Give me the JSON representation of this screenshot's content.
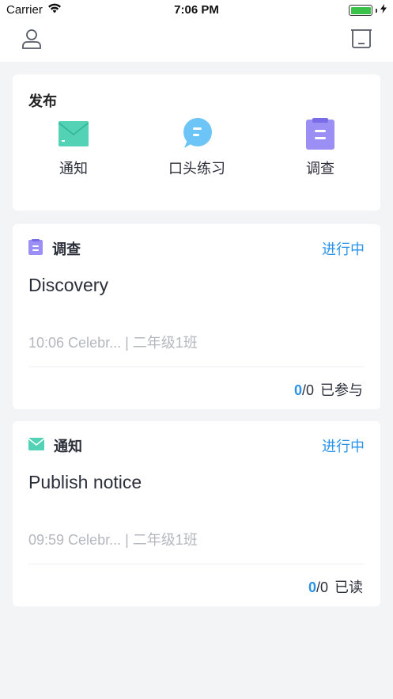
{
  "status_bar": {
    "carrier": "Carrier",
    "time": "7:06 PM",
    "battery_level": 1.0
  },
  "nav": {
    "left_icon": "user-icon",
    "right_icon": "inbox-icon"
  },
  "publish": {
    "title": "发布",
    "items": [
      {
        "label": "通知",
        "icon": "mail-icon",
        "color": "#53d2b5"
      },
      {
        "label": "口头练习",
        "icon": "chat-bubble-icon",
        "color": "#6cc4f7"
      },
      {
        "label": "调查",
        "icon": "clipboard-icon",
        "color": "#9b8ef5"
      }
    ]
  },
  "cards": [
    {
      "type": "调查",
      "icon": "clipboard-icon",
      "status": "进行中",
      "title": "Discovery",
      "meta": "10:06 Celebr... | 二年级1班",
      "count_done": "0",
      "count_total": "/0",
      "count_label": "已参与"
    },
    {
      "type": "通知",
      "icon": "mail-icon",
      "status": "进行中",
      "title": "Publish notice",
      "meta": "09:59 Celebr... | 二年级1班",
      "count_done": "0",
      "count_total": "/0",
      "count_label": "已读"
    }
  ],
  "colors": {
    "accent": "#2a93e8",
    "background": "#f3f4f6",
    "muted_text": "#b4b7be"
  }
}
